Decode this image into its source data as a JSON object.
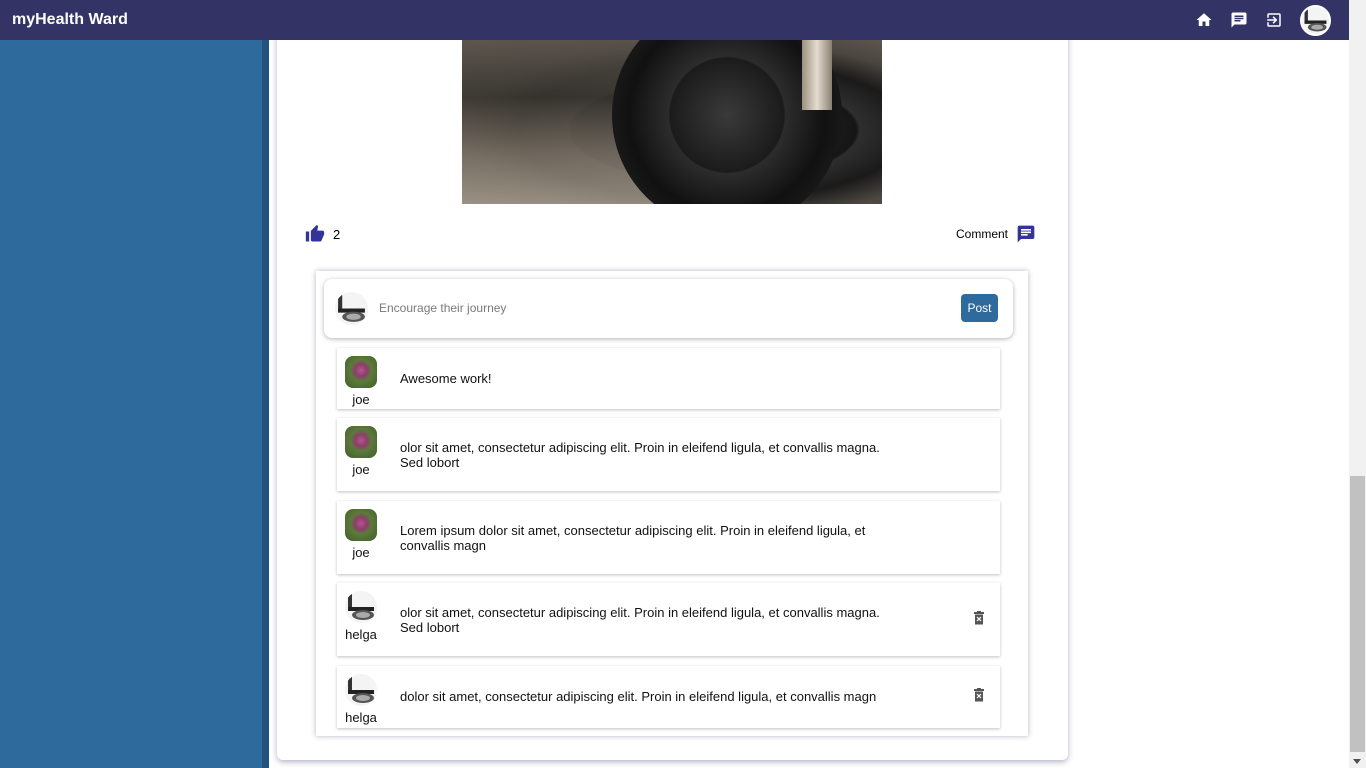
{
  "header": {
    "brand": "myHealth Ward",
    "icons": [
      "home-icon",
      "chat-icon",
      "logout-icon"
    ],
    "bg_color": "#333366"
  },
  "sidebar": {
    "color": "#2f6a9c"
  },
  "post": {
    "likes": "2",
    "comment_label": "Comment",
    "image": "dumbbell-weight-plate-photo"
  },
  "compose": {
    "placeholder": "Encourage their journey",
    "post_label": "Post"
  },
  "comments": [
    {
      "author": "joe",
      "text": "Awesome work!",
      "deletable": false
    },
    {
      "author": "joe",
      "text": "olor sit amet, consectetur adipiscing elit. Proin in eleifend ligula, et convallis magna. Sed lobort",
      "deletable": false
    },
    {
      "author": "joe",
      "text": "Lorem ipsum dolor sit amet, consectetur adipiscing elit. Proin in eleifend ligula, et convallis magn",
      "deletable": false
    },
    {
      "author": "helga",
      "text": "olor sit amet, consectetur adipiscing elit. Proin in eleifend ligula, et convallis magna. Sed lobort",
      "deletable": true
    },
    {
      "author": "helga",
      "text": "dolor sit amet, consectetur adipiscing elit. Proin in eleifend ligula, et convallis magn",
      "deletable": true
    }
  ]
}
